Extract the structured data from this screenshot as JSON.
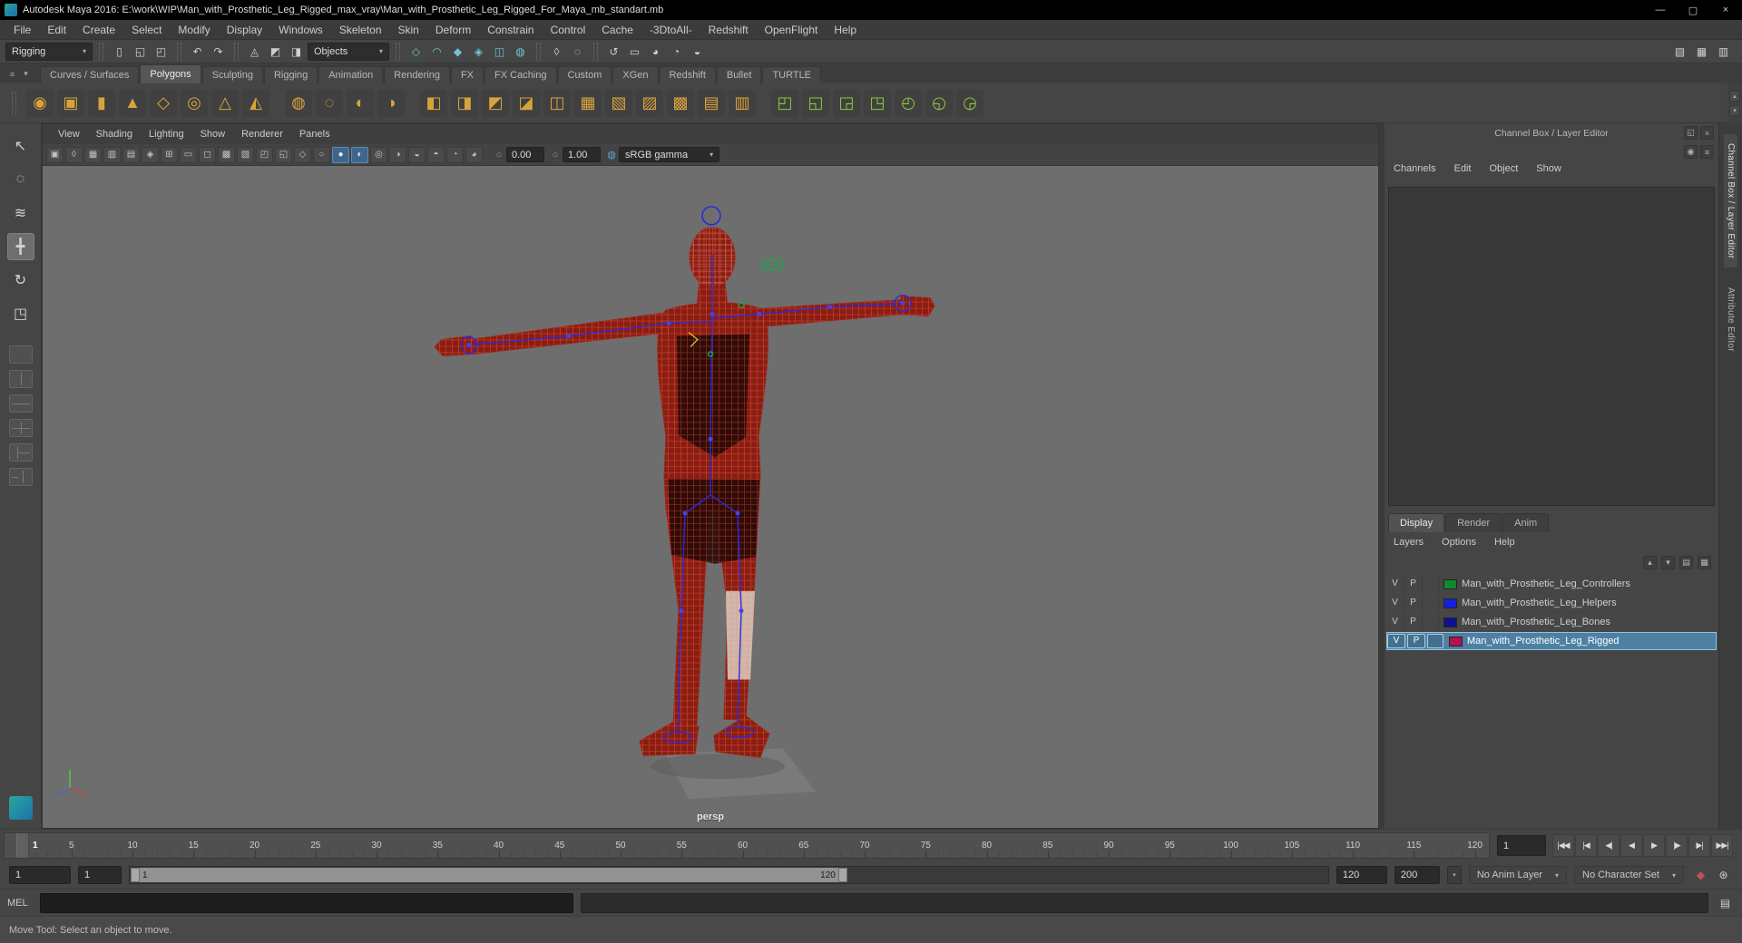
{
  "ui": {
    "chevron_down": "▾",
    "chevron_up": "▴",
    "menu_glyph": "≡"
  },
  "window": {
    "title": "Autodesk Maya 2016: E:\\work\\WIP\\Man_with_Prosthetic_Leg_Rigged_max_vray\\Man_with_Prosthetic_Leg_Rigged_For_Maya_mb_standart.mb",
    "controls": [
      {
        "n": "minimize-button",
        "g": "—"
      },
      {
        "n": "maximize-button",
        "g": "▢"
      },
      {
        "n": "close-button",
        "g": "×"
      }
    ]
  },
  "menu_bar": {
    "items": [
      "File",
      "Edit",
      "Create",
      "Select",
      "Modify",
      "Display",
      "Windows",
      "Skeleton",
      "Skin",
      "Deform",
      "Constrain",
      "Control",
      "Cache",
      "-3DtoAll-",
      "Redshift",
      "OpenFlight",
      "Help"
    ]
  },
  "status_line": {
    "items": [
      {
        "t": "dd",
        "n": "menu-set-selector",
        "label": "Rigging",
        "w": 96
      },
      {
        "t": "grip"
      },
      {
        "t": "icon",
        "n": "new-scene-icon",
        "g": "▯"
      },
      {
        "t": "icon",
        "n": "open-scene-icon",
        "g": "◱"
      },
      {
        "t": "icon",
        "n": "save-scene-icon",
        "g": "◰"
      },
      {
        "t": "grip"
      },
      {
        "t": "icon",
        "n": "undo-icon",
        "g": "↶"
      },
      {
        "t": "icon",
        "n": "redo-icon",
        "g": "↷"
      },
      {
        "t": "grip"
      },
      {
        "t": "icon",
        "n": "select-by-hierarchy-icon",
        "g": "◬"
      },
      {
        "t": "icon",
        "n": "select-by-object-icon",
        "g": "◩"
      },
      {
        "t": "icon",
        "n": "select-by-component-icon",
        "g": "◨"
      },
      {
        "t": "dd",
        "n": "selection-mask-selector",
        "label": "Objects",
        "w": 90
      },
      {
        "t": "grip"
      },
      {
        "t": "icon",
        "n": "snap-to-grid-icon",
        "g": "◇",
        "c": "#6fc4d6"
      },
      {
        "t": "icon",
        "n": "snap-to-curve-icon",
        "g": "◠",
        "c": "#6fc4d6"
      },
      {
        "t": "icon",
        "n": "snap-to-point-icon",
        "g": "◆",
        "c": "#6fc4d6"
      },
      {
        "t": "icon",
        "n": "snap-to-projected-center-icon",
        "g": "◈",
        "c": "#6fc4d6"
      },
      {
        "t": "icon",
        "n": "snap-to-view-plane-icon",
        "g": "◫",
        "c": "#6fc4d6"
      },
      {
        "t": "icon",
        "n": "make-live-icon",
        "g": "◍",
        "c": "#6fc4d6"
      },
      {
        "t": "grip"
      },
      {
        "t": "icon",
        "n": "lock-selection-icon",
        "g": "◊"
      },
      {
        "t": "icon",
        "n": "highlight-selection-icon",
        "g": "◌"
      },
      {
        "t": "grip"
      },
      {
        "t": "icon",
        "n": "construction-history-icon",
        "g": "↺"
      },
      {
        "t": "icon",
        "n": "open-render-view-icon",
        "g": "▭"
      },
      {
        "t": "icon",
        "n": "render-current-frame-icon",
        "g": "◕"
      },
      {
        "t": "icon",
        "n": "ipr-render-icon",
        "g": "◔"
      },
      {
        "t": "icon",
        "n": "render-settings-icon",
        "g": "◒"
      }
    ],
    "right_items": [
      {
        "n": "show-tool-settings-icon",
        "g": "▧"
      },
      {
        "n": "show-attribute-editor-icon",
        "g": "▦"
      },
      {
        "n": "show-channel-box-icon",
        "g": "▥"
      }
    ]
  },
  "shelf": {
    "tabs": [
      "Curves / Surfaces",
      "Polygons",
      "Sculpting",
      "Rigging",
      "Animation",
      "Rendering",
      "FX",
      "FX Caching",
      "Custom",
      "XGen",
      "Redshift",
      "Bullet",
      "TURTLE"
    ],
    "active_tab": "Polygons",
    "gold_color": "#d9a33c",
    "green_color": "#8ec63f",
    "icons": [
      {
        "n": "poly-sphere-icon",
        "g": "◉"
      },
      {
        "n": "poly-cube-icon",
        "g": "▣"
      },
      {
        "n": "poly-cylinder-icon",
        "g": "▮"
      },
      {
        "n": "poly-cone-icon",
        "g": "▲"
      },
      {
        "n": "poly-plane-icon",
        "g": "◇"
      },
      {
        "n": "poly-torus-icon",
        "g": "◎"
      },
      {
        "n": "poly-prism-icon",
        "g": "△"
      },
      {
        "n": "poly-pyramid-icon",
        "g": "◭"
      },
      {
        "t": "gap"
      },
      {
        "n": "poly-pipe-icon",
        "g": "◍"
      },
      {
        "n": "poly-helix-icon",
        "g": "◌"
      },
      {
        "n": "poly-soccer-ball-icon",
        "g": "◐"
      },
      {
        "n": "poly-platonic-icon",
        "g": "◑"
      },
      {
        "t": "gap"
      },
      {
        "n": "poly-combine-icon",
        "g": "◧"
      },
      {
        "n": "poly-separate-icon",
        "g": "◨"
      },
      {
        "n": "poly-extract-icon",
        "g": "◩"
      },
      {
        "n": "poly-boolean-icon",
        "g": "◪"
      },
      {
        "n": "poly-bevel-icon",
        "g": "◫"
      },
      {
        "n": "poly-bridge-icon",
        "g": "▦"
      },
      {
        "n": "poly-extrude-icon",
        "g": "▧"
      },
      {
        "n": "multi-cut-icon",
        "g": "▨"
      },
      {
        "n": "target-weld-icon",
        "g": "▩"
      },
      {
        "n": "quad-draw-icon",
        "g": "▤"
      },
      {
        "n": "mirror-icon",
        "g": "▥"
      },
      {
        "t": "gap"
      },
      {
        "n": "smooth-icon",
        "g": "◰",
        "c": "#8ec63f"
      },
      {
        "n": "reduce-icon",
        "g": "◱",
        "c": "#8ec63f"
      },
      {
        "n": "tweak-icon",
        "g": "◲",
        "c": "#8ec63f"
      },
      {
        "n": "spin-edge-icon",
        "g": "◳",
        "c": "#8ec63f"
      },
      {
        "n": "crease-icon",
        "g": "◴",
        "c": "#8ec63f"
      },
      {
        "n": "connect-icon",
        "g": "◵",
        "c": "#8ec63f"
      },
      {
        "n": "cut-icon",
        "g": "◶",
        "c": "#8ec63f"
      }
    ]
  },
  "toolbox": {
    "tools": [
      {
        "n": "select-tool-button",
        "g": "↖"
      },
      {
        "n": "lasso-tool-button",
        "g": "◌"
      },
      {
        "n": "paint-select-tool-button",
        "g": "≋"
      },
      {
        "n": "move-tool-button",
        "g": "╋",
        "active": true
      },
      {
        "n": "rotate-tool-button",
        "g": "↻"
      },
      {
        "n": "scale-tool-button",
        "g": "◳"
      }
    ],
    "layouts": [
      "layout-single-pane-button",
      "layout-two-pane-side-by-side-button",
      "layout-two-pane-stacked-button",
      "layout-four-pane-button",
      "layout-three-pane-split-button",
      "layout-outliner-persp-button"
    ],
    "bottom_icon": {
      "n": "toolbox-extra-icon"
    }
  },
  "viewport": {
    "menus": [
      "View",
      "Shading",
      "Lighting",
      "Show",
      "Renderer",
      "Panels"
    ],
    "icons": [
      {
        "n": "select-camera-icon",
        "g": "▣"
      },
      {
        "n": "lock-camera-icon",
        "g": "◊"
      },
      {
        "n": "camera-attributes-icon",
        "g": "▦"
      },
      {
        "n": "bookmarks-icon",
        "g": "▥"
      },
      {
        "n": "image-plane-icon",
        "g": "▤"
      },
      {
        "n": "2d-pan-zoom-icon",
        "g": "◈"
      },
      {
        "n": "grid-icon",
        "g": "⊞"
      },
      {
        "n": "film-gate-icon",
        "g": "▭"
      },
      {
        "n": "resolution-gate-icon",
        "g": "◻"
      },
      {
        "n": "gate-mask-icon",
        "g": "▩"
      },
      {
        "n": "field-chart-icon",
        "g": "▧"
      },
      {
        "n": "safe-action-icon",
        "g": "◰"
      },
      {
        "n": "safe-title-icon",
        "g": "◱"
      },
      {
        "n": "frame-all-icon",
        "g": "◇"
      },
      {
        "n": "wireframe-icon",
        "g": "○"
      },
      {
        "n": "shaded-icon",
        "g": "●",
        "a": true
      },
      {
        "n": "textured-icon",
        "g": "◐",
        "a": true
      },
      {
        "n": "use-all-lights-icon",
        "g": "◎"
      },
      {
        "n": "shadows-icon",
        "g": "◑"
      },
      {
        "n": "ssao-icon",
        "g": "◒"
      },
      {
        "n": "motion-blur-icon",
        "g": "◓"
      },
      {
        "n": "xray-icon",
        "g": "◔"
      },
      {
        "n": "isolate-select-icon",
        "g": "◕"
      }
    ],
    "exposure_icon": {
      "n": "exposure-toggle-icon",
      "g": "○"
    },
    "exposure": "0.00",
    "gamma_icon": {
      "n": "gamma-toggle-icon",
      "g": "○"
    },
    "gamma": "1.00",
    "colorspace_icon": {
      "n": "color-management-icon",
      "g": "◍"
    },
    "colorspace": "sRGB gamma",
    "camera_label": "persp"
  },
  "channel_box": {
    "header": "Channel Box / Layer Editor",
    "header_icons": [
      {
        "n": "dock-panel-icon",
        "g": "◱"
      },
      {
        "n": "close-panel-icon",
        "g": "×"
      }
    ],
    "option_icons": [
      {
        "n": "channel-display-icon",
        "g": "◉"
      },
      {
        "n": "channel-settings-icon",
        "g": "≡"
      }
    ],
    "menus": [
      "Channels",
      "Edit",
      "Object",
      "Show"
    ],
    "layer_tabs": [
      "Display",
      "Render",
      "Anim"
    ],
    "active_layer_tab": "Display",
    "layer_menus": [
      "Layers",
      "Options",
      "Help"
    ],
    "layer_icons": [
      {
        "n": "layer-move-up-icon",
        "g": "▴"
      },
      {
        "n": "layer-move-down-icon",
        "g": "▾"
      },
      {
        "n": "create-empty-layer-icon",
        "g": "▤"
      },
      {
        "n": "create-layer-from-selected-icon",
        "g": "▦"
      }
    ],
    "selection_color": "#4e81a1",
    "layers": [
      {
        "v": "V",
        "p": "P",
        "color": "#128a2c",
        "name": "Man_with_Prosthetic_Leg_Controllers",
        "selected": false
      },
      {
        "v": "V",
        "p": "P",
        "color": "#1420e0",
        "name": "Man_with_Prosthetic_Leg_Helpers",
        "selected": false
      },
      {
        "v": "V",
        "p": "P",
        "color": "#10128c",
        "name": "Man_with_Prosthetic_Leg_Bones",
        "selected": false
      },
      {
        "v": "V",
        "p": "P",
        "color": "#b4124e",
        "name": "Man_with_Prosthetic_Leg_Rigged",
        "selected": true
      }
    ]
  },
  "side_panel": {
    "tabs": [
      {
        "label": "Channel Box / Layer Editor",
        "active": true
      },
      {
        "label": "Attribute Editor",
        "active": false
      }
    ]
  },
  "timeline": {
    "marker_label": "1",
    "current_field": "1",
    "tick_labels": [
      5,
      10,
      15,
      20,
      25,
      30,
      35,
      40,
      45,
      50,
      55,
      60,
      65,
      70,
      75,
      80,
      85,
      90,
      95,
      100,
      105,
      110,
      115,
      120
    ]
  },
  "playback": {
    "buttons": [
      {
        "n": "go-to-range-start-button",
        "g": "|◀◀"
      },
      {
        "n": "step-back-frame-button",
        "g": "|◀"
      },
      {
        "n": "step-back-key-button",
        "g": "◀|"
      },
      {
        "n": "play-backwards-button",
        "g": "◀"
      },
      {
        "n": "play-forwards-button",
        "g": "▶"
      },
      {
        "n": "step-forward-key-button",
        "g": "|▶"
      },
      {
        "n": "step-forward-frame-button",
        "g": "▶|"
      },
      {
        "n": "go-to-range-end-button",
        "g": "▶▶|"
      }
    ]
  },
  "range_slider": {
    "animation_start": "1",
    "playback_start": "1",
    "range_start_label": "1",
    "range_end_label": "120",
    "playback_end": "120",
    "animation_end": "200",
    "anim_layer_label": "No Anim Layer",
    "character_set_label": "No Character Set",
    "icons": [
      {
        "n": "auto-keyframe-icon",
        "g": "◆",
        "c": "#c65050"
      },
      {
        "n": "animation-preferences-icon",
        "g": "⊛"
      }
    ]
  },
  "command_line": {
    "label": "MEL",
    "icons": [
      {
        "n": "script-editor-icon",
        "g": "▤"
      }
    ]
  },
  "help_line": {
    "text": "Move Tool: Select an object to move."
  }
}
